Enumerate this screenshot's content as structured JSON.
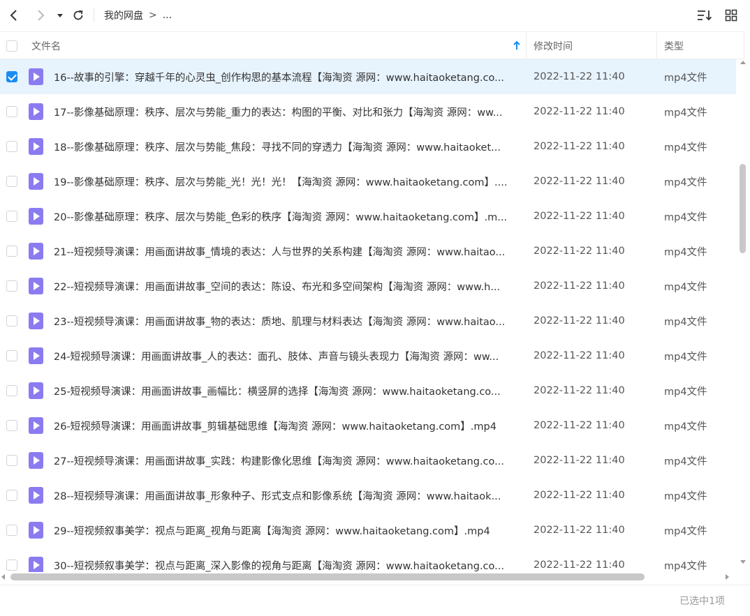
{
  "toolbar": {
    "back_icon": "chevron-left-icon",
    "forward_icon": "chevron-right-icon",
    "dropdown_icon": "caret-down-icon",
    "refresh_icon": "refresh-icon",
    "sort_icon": "sort-list-icon",
    "view_icon": "grid-view-icon"
  },
  "breadcrumb": {
    "root": "我的网盘",
    "separator": ">",
    "more": "..."
  },
  "columns": {
    "name": "文件名",
    "modified": "修改时间",
    "type": "类型"
  },
  "accent_color": "#1a8cf0",
  "icon_color": "#8a7cf0",
  "files": [
    {
      "name": "16--故事的引擎：穿越千年的心灵虫_创作构思的基本流程【海淘资 源网：www.haitaoketang.co...",
      "modified": "2022-11-22 11:40",
      "type": "mp4文件",
      "selected": true
    },
    {
      "name": "17--影像基础原理：秩序、层次与势能_重力的表达：构图的平衡、对比和张力【海淘资 源网：ww...",
      "modified": "2022-11-22 11:40",
      "type": "mp4文件",
      "selected": false
    },
    {
      "name": "18--影像基础原理：秩序、层次与势能_焦段：寻找不同的穿透力【海淘资 源网：www.haitaoket...",
      "modified": "2022-11-22 11:40",
      "type": "mp4文件",
      "selected": false
    },
    {
      "name": "19--影像基础原理：秩序、层次与势能_光！光！光！【海淘资 源网：www.haitaoketang.com】....",
      "modified": "2022-11-22 11:40",
      "type": "mp4文件",
      "selected": false
    },
    {
      "name": "20--影像基础原理：秩序、层次与势能_色彩的秩序【海淘资 源网：www.haitaoketang.com】.m...",
      "modified": "2022-11-22 11:40",
      "type": "mp4文件",
      "selected": false
    },
    {
      "name": "21--短视频导演课：用画面讲故事_情境的表达：人与世界的关系构建【海淘资 源网：www.haitao...",
      "modified": "2022-11-22 11:40",
      "type": "mp4文件",
      "selected": false
    },
    {
      "name": "22--短视频导演课：用画面讲故事_空间的表达：陈设、布光和多空间架构【海淘资 源网：www.h...",
      "modified": "2022-11-22 11:40",
      "type": "mp4文件",
      "selected": false
    },
    {
      "name": "23--短视频导演课：用画面讲故事_物的表达：质地、肌理与材料表达【海淘资 源网：www.haitao...",
      "modified": "2022-11-22 11:40",
      "type": "mp4文件",
      "selected": false
    },
    {
      "name": "24-短视频导演课：用画面讲故事_人的表达：面孔、肢体、声音与镜头表现力【海淘资 源网：ww...",
      "modified": "2022-11-22 11:40",
      "type": "mp4文件",
      "selected": false
    },
    {
      "name": "25-短视频导演课：用画面讲故事_画幅比：横竖屏的选择【海淘资 源网：www.haitaoketang.co...",
      "modified": "2022-11-22 11:40",
      "type": "mp4文件",
      "selected": false
    },
    {
      "name": "26-短视频导演课：用画面讲故事_剪辑基础思维【海淘资 源网：www.haitaoketang.com】.mp4",
      "modified": "2022-11-22 11:40",
      "type": "mp4文件",
      "selected": false
    },
    {
      "name": "27--短视频导演课：用画面讲故事_实践：构建影像化思维【海淘资 源网：www.haitaoketang.co...",
      "modified": "2022-11-22 11:40",
      "type": "mp4文件",
      "selected": false
    },
    {
      "name": "28--短视频导演课：用画面讲故事_形象种子、形式支点和影像系统【海淘资 源网：www.haitaok...",
      "modified": "2022-11-22 11:40",
      "type": "mp4文件",
      "selected": false
    },
    {
      "name": "29--短视频叙事美学：视点与距离_视角与距离【海淘资 源网：www.haitaoketang.com】.mp4",
      "modified": "2022-11-22 11:40",
      "type": "mp4文件",
      "selected": false
    },
    {
      "name": "30--短视频叙事美学：视点与距离_深入影像的视角与距离【海淘资 源网：www.haitaoketang.co...",
      "modified": "2022-11-22 11:40",
      "type": "mp4文件",
      "selected": false
    }
  ],
  "status": {
    "selected_text": "已选中1项"
  }
}
